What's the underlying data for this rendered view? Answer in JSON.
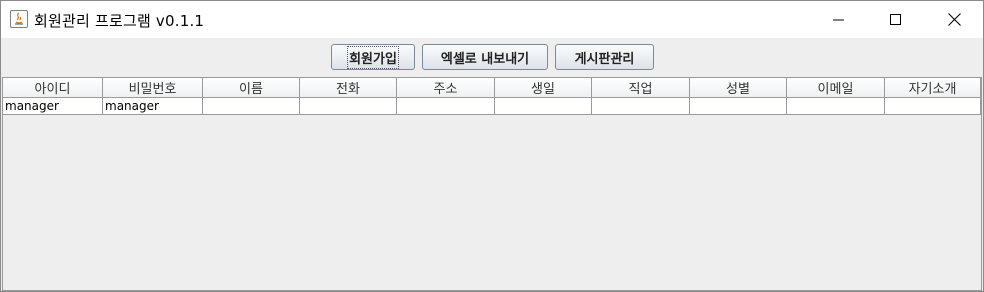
{
  "window": {
    "title": "회원관리 프로그램  v0.1.1",
    "controls": [
      "minimize-icon",
      "maximize-icon",
      "close-icon"
    ]
  },
  "toolbar": {
    "signup_label": "회원가입",
    "export_label": "엑셀로 내보내기",
    "board_label": "게시판관리"
  },
  "table": {
    "columns": [
      "아이디",
      "비밀번호",
      "이름",
      "전화",
      "주소",
      "생일",
      "직업",
      "성별",
      "이메일",
      "자기소개"
    ],
    "rows": [
      [
        "manager",
        "manager",
        "",
        "",
        "",
        "",
        "",
        "",
        "",
        ""
      ]
    ]
  }
}
